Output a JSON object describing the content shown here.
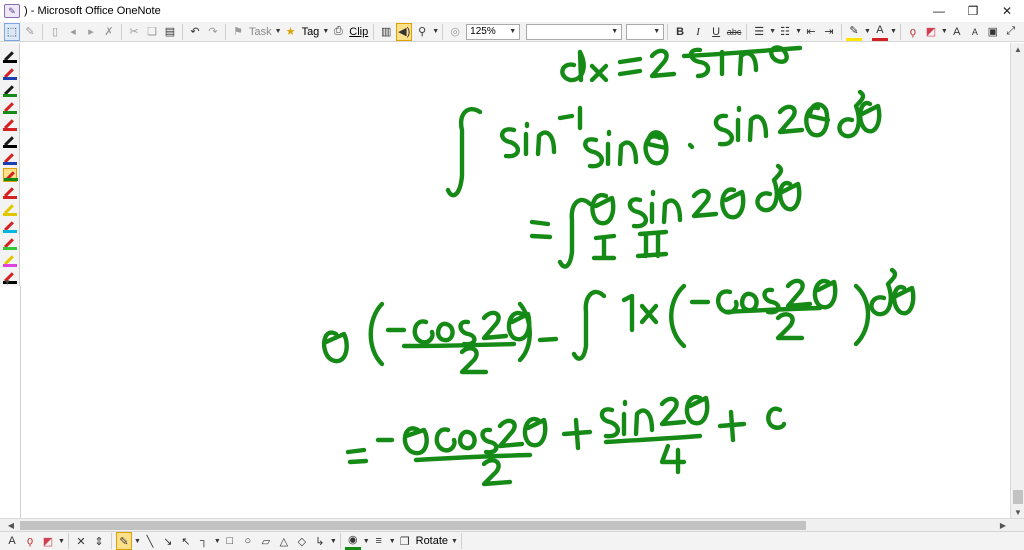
{
  "window": {
    "title": ") - Microsoft Office OneNote",
    "minimize_glyph": "—",
    "restore_glyph": "❐",
    "close_glyph": "✕"
  },
  "toolbar": {
    "task_label": "Task",
    "tag_label": "Tag",
    "clip_label": "Clip",
    "zoom_value": "125%",
    "font_value": "",
    "size_value": "",
    "bold_label": "B",
    "italic_label": "I",
    "underline_label": "U",
    "strike_label": "abc",
    "font_size_up_label": "A",
    "font_size_down_label": "A"
  },
  "drawbar": {
    "text_tool_label": "A",
    "rotate_label": "Rotate"
  },
  "pens": [
    {
      "color": "#1a1a1a",
      "base": "#000000"
    },
    {
      "color": "#d42020",
      "base": "#1a3fb0"
    },
    {
      "color": "#1a1a1a",
      "base": "#168a16"
    },
    {
      "color": "#d42020",
      "base": "#168a16"
    },
    {
      "color": "#d42020",
      "base": "#d42020"
    },
    {
      "color": "#1a1a1a",
      "base": "#000000"
    },
    {
      "color": "#d42020",
      "base": "#1a3fb0"
    },
    {
      "color": "#d42020",
      "base": "#168a16",
      "selected": true
    },
    {
      "color": "#d42020",
      "base": "#d42020"
    },
    {
      "color": "#e0c800",
      "base": "#e0c800"
    },
    {
      "color": "#d42020",
      "base": "#00b7e0"
    },
    {
      "color": "#d42020",
      "base": "#36c836"
    },
    {
      "color": "#e0c800",
      "base": "#e040e0"
    },
    {
      "color": "#d42020",
      "base": "#000000"
    }
  ],
  "colors": {
    "ink": "#168a16",
    "toolbar_bg": "#f3f3f3",
    "active_button": "#ffe08a"
  }
}
